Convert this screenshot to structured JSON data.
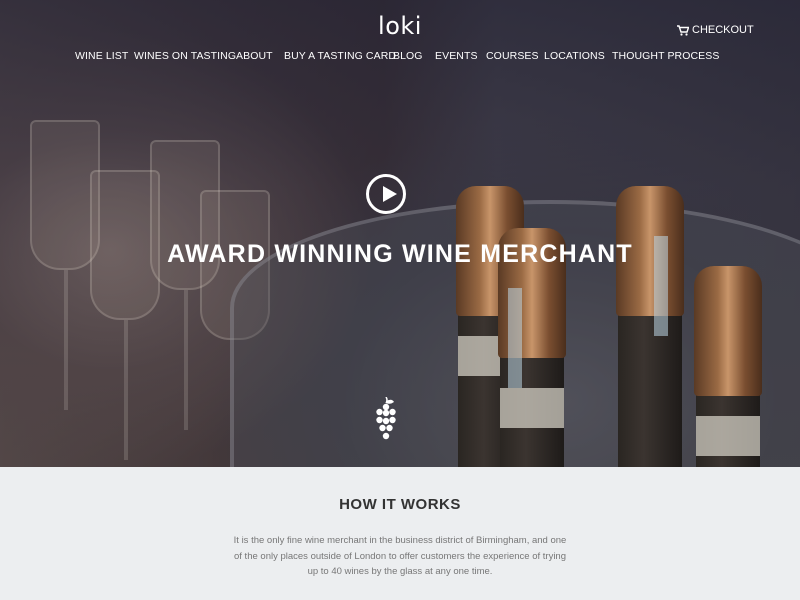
{
  "brand": {
    "logo_text": "loki"
  },
  "header": {
    "checkout_label": "CHECKOUT",
    "nav": [
      {
        "label": "WINE LIST"
      },
      {
        "label": "WINES ON TASTING"
      },
      {
        "label": "ABOUT"
      },
      {
        "label": "BUY A TASTING CARD"
      },
      {
        "label": "BLOG"
      },
      {
        "label": "EVENTS"
      },
      {
        "label": "COURSES"
      },
      {
        "label": "LOCATIONS"
      },
      {
        "label": "THOUGHT PROCESS"
      }
    ]
  },
  "hero": {
    "headline": "AWARD WINNING WINE MERCHANT",
    "play_icon": "play-circle-icon",
    "grape_icon": "grape-icon"
  },
  "how_it_works": {
    "title": "HOW IT WORKS",
    "text": "It is the only fine wine merchant in the business district of Birmingham, and one of the only places outside of London to offer customers the experience of trying up to 40 wines by the glass at any one time."
  },
  "colors": {
    "nav_text": "#ffffff",
    "section_background": "#eceef0",
    "body_text": "#777777"
  }
}
